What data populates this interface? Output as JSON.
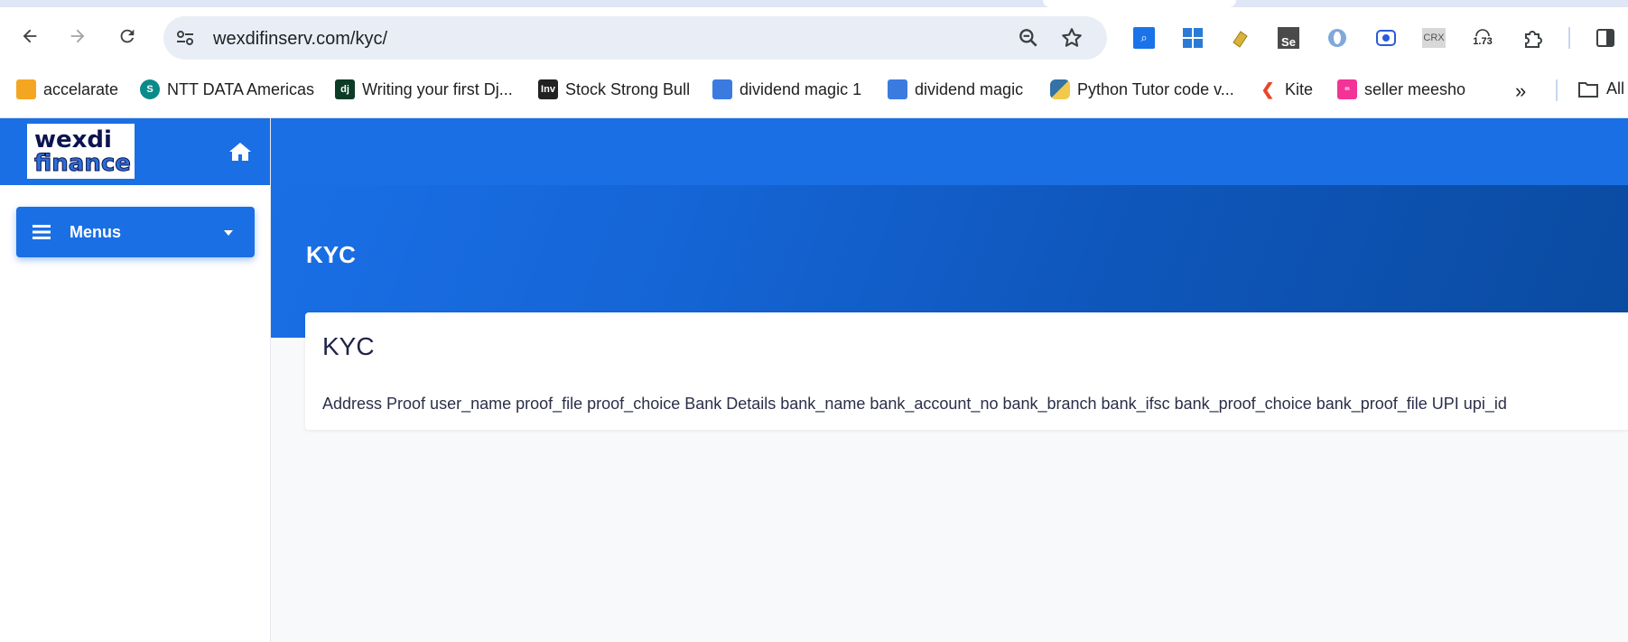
{
  "browser": {
    "url": "wexdifinserv.com/kyc/",
    "extensions": [
      "search-extension-icon",
      "windows-extension-icon",
      "gold-bar-extension-icon",
      "selenium-extension-icon",
      "opera-extension-icon",
      "record-extension-icon",
      "crx-extension-icon",
      "speedometer-extension-icon",
      "puzzle-extensions-icon",
      "side-panel-icon"
    ],
    "crx_label": "CRX",
    "speed_value": "1.73"
  },
  "bookmarks": [
    {
      "label": "accelarate",
      "icon": "stack-icon",
      "color": "#f4a623"
    },
    {
      "label": "NTT DATA Americas",
      "icon": "sharepoint-icon",
      "color": "#0b8a8a"
    },
    {
      "label": "Writing your first Dj...",
      "icon": "django-icon",
      "color": "#0c3c26"
    },
    {
      "label": "Stock Strong Bull",
      "icon": "investing-icon",
      "color": "#222222"
    },
    {
      "label": "dividend magic 1",
      "icon": "doc-icon",
      "color": "#3b7be0"
    },
    {
      "label": "dividend magic",
      "icon": "doc-icon",
      "color": "#3b7be0"
    },
    {
      "label": "Python Tutor code v...",
      "icon": "python-icon",
      "color": "#3572a5"
    },
    {
      "label": "Kite",
      "icon": "kite-icon",
      "color": "#e8462a"
    },
    {
      "label": "seller meesho",
      "icon": "meesho-icon",
      "color": "#f43397"
    }
  ],
  "bookmarks_overflow": "»",
  "bookmarks_all": "All",
  "sidebar": {
    "logo_line1": "wexdi",
    "logo_line2": "finance",
    "menus_label": "Menus"
  },
  "hero": {
    "title": "KYC"
  },
  "card": {
    "title": "KYC",
    "text": "Address Proof user_name proof_file proof_choice Bank Details bank_name bank_account_no bank_branch bank_ifsc bank_proof_choice bank_proof_file UPI upi_id"
  },
  "colors": {
    "primary": "#1b6fe4",
    "dark": "#0a4ba1",
    "text": "#1f2347"
  }
}
